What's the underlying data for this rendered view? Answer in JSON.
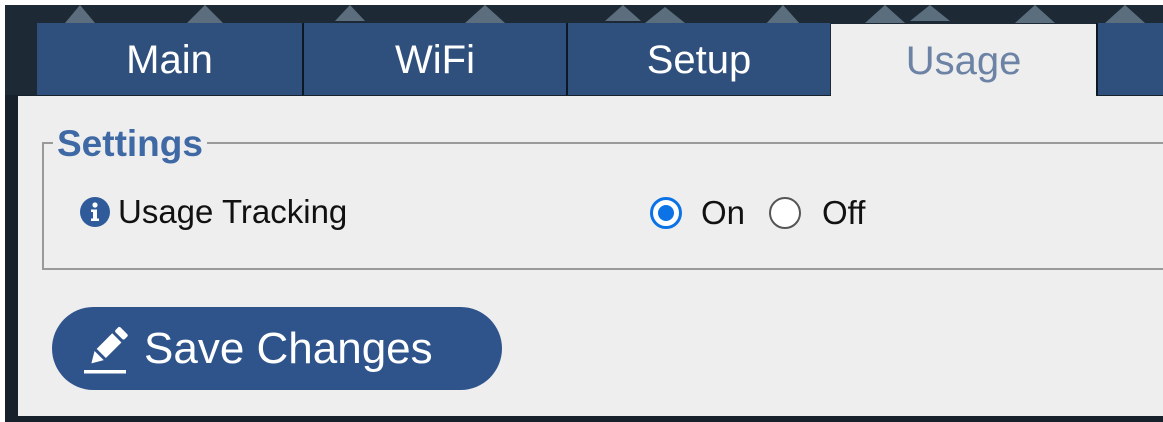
{
  "tabs": [
    {
      "label": "Main",
      "active": false
    },
    {
      "label": "WiFi",
      "active": false
    },
    {
      "label": "Setup",
      "active": false
    },
    {
      "label": "Usage",
      "active": true
    }
  ],
  "settings": {
    "legend": "Settings",
    "usage_tracking": {
      "label": "Usage Tracking",
      "icon": "info-icon",
      "options": [
        {
          "label": "On",
          "checked": true
        },
        {
          "label": "Off",
          "checked": false
        }
      ]
    }
  },
  "actions": {
    "save_label": "Save Changes",
    "save_icon": "pencil-icon"
  },
  "colors": {
    "tab_bg": "#2f4f7c",
    "active_tab_text": "#6c83a6",
    "legend_text": "#3f69a5",
    "radio_accent": "#0b73e6",
    "button_bg": "#2f548c",
    "panel_bg": "#eeeeee"
  }
}
